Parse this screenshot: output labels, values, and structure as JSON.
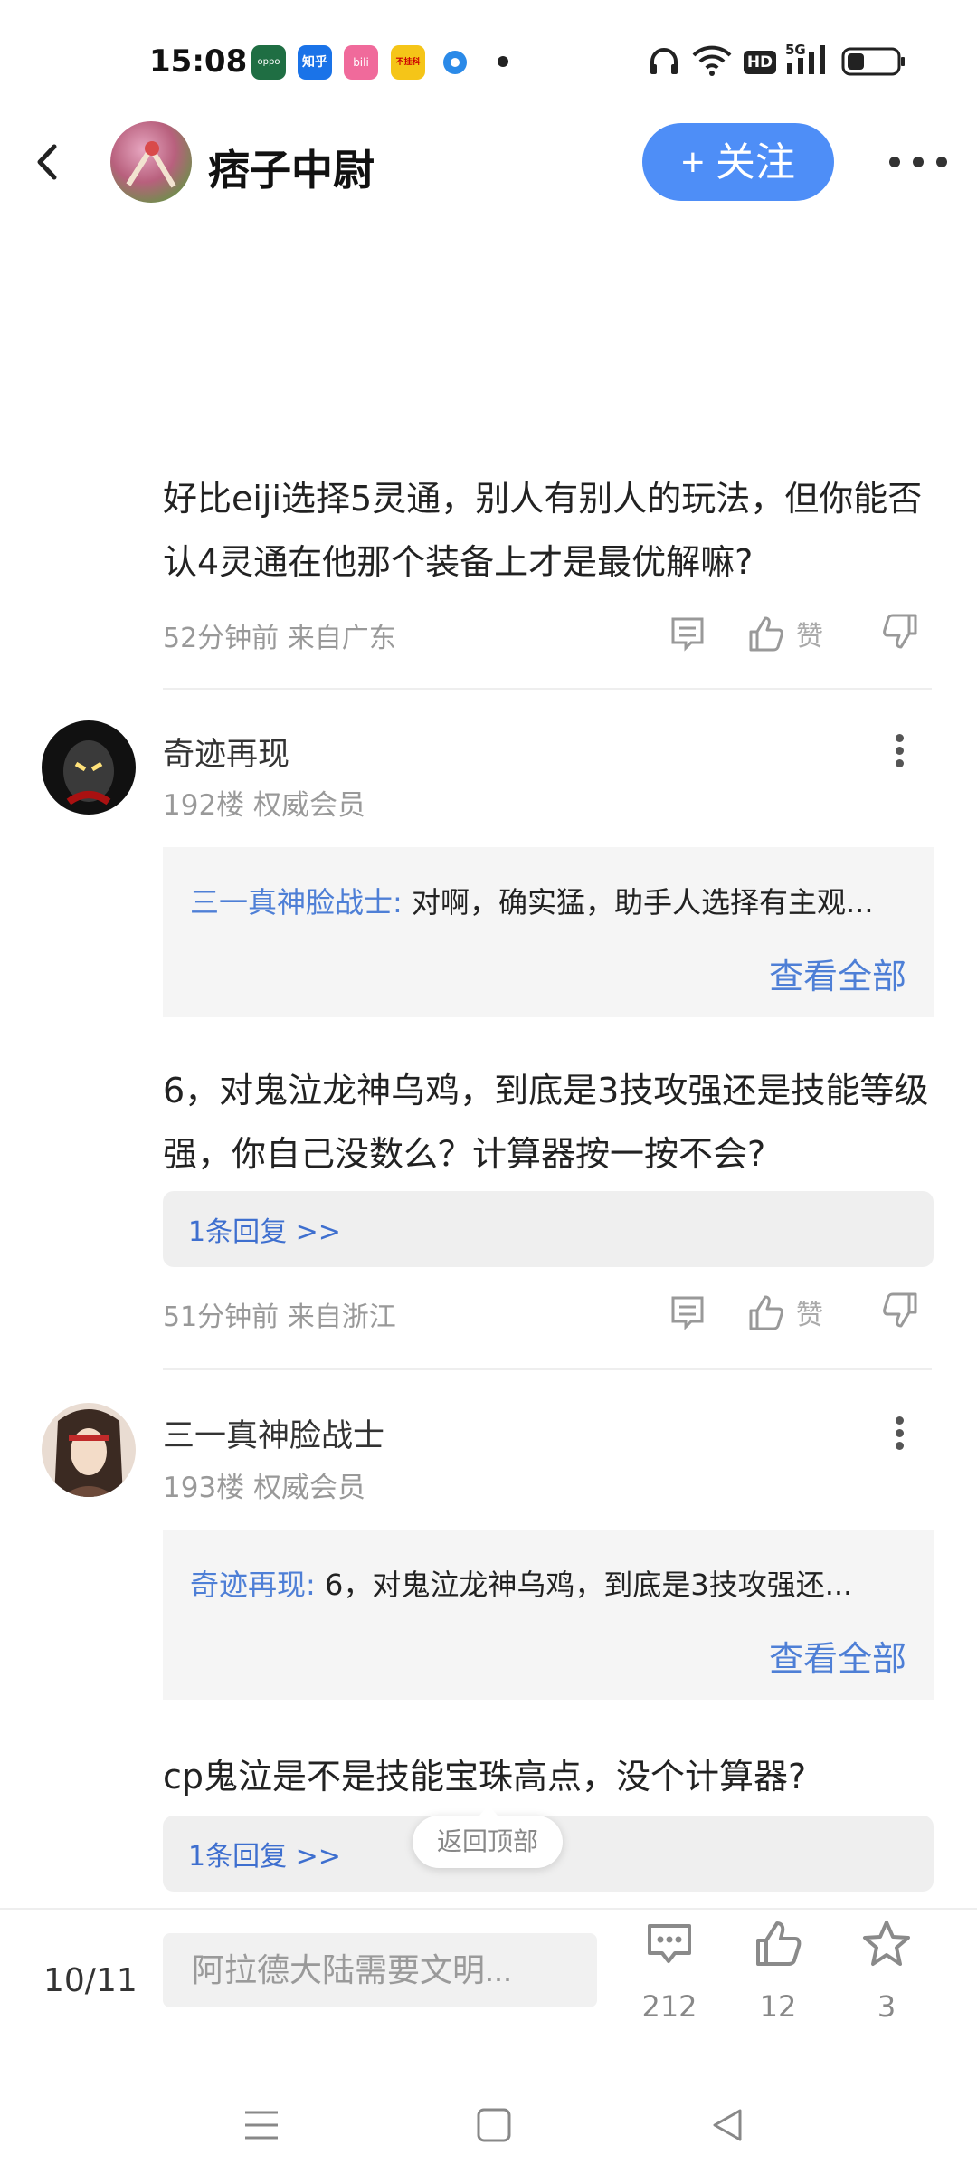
{
  "status_bar": {
    "time": "15:08",
    "app_icons": [
      {
        "name": "oppo",
        "label": "oppo",
        "color": "#1f6e43"
      },
      {
        "name": "zhihu",
        "label": "知乎",
        "color": "#1a73e8"
      },
      {
        "name": "bilibili",
        "label": "bili",
        "color": "#f06a9b"
      },
      {
        "name": "buhuicu",
        "label": "不挂科",
        "color": "#f5c518"
      }
    ],
    "network": "5G",
    "hd": "HD"
  },
  "header": {
    "title": "痞子中尉",
    "follow_label": "+ 关注"
  },
  "posts": [
    {
      "text": "好比eiji选择5灵通，别人有别人的玩法，但你能否认4灵通在他那个装备上才是最优解嘛?",
      "meta": "52分钟前 来自广东",
      "like_label": "赞"
    },
    {
      "user": "奇迹再现",
      "floor": "192楼 权威会员",
      "quote_name": "三一真神脸战士:",
      "quote_text": " 对啊，确实猛，助手人选择有主观...",
      "view_all": "查看全部",
      "text": "6，对鬼泣龙神乌鸡，到底是3技攻强还是技能等级强，你自己没数么？计算器按一按不会?",
      "reply_link": "1条回复 >>",
      "meta": "51分钟前 来自浙江",
      "like_label": "赞"
    },
    {
      "user": "三一真神脸战士",
      "floor": "193楼 权威会员",
      "quote_name": "奇迹再现:",
      "quote_text": " 6，对鬼泣龙神乌鸡，到底是3技攻强还...",
      "view_all": "查看全部",
      "text": "cp鬼泣是不是技能宝珠高点，没个计算器?",
      "reply_link": "1条回复 >>"
    }
  ],
  "back_to_top": "返回顶部",
  "bottom_bar": {
    "page_indicator": "10/11",
    "input_placeholder": "阿拉德大陆需要文明...",
    "comment_count": "212",
    "like_count": "12",
    "favorite_count": "3"
  },
  "colors": {
    "accent": "#4e8ef7",
    "link": "#4e7fd6"
  }
}
